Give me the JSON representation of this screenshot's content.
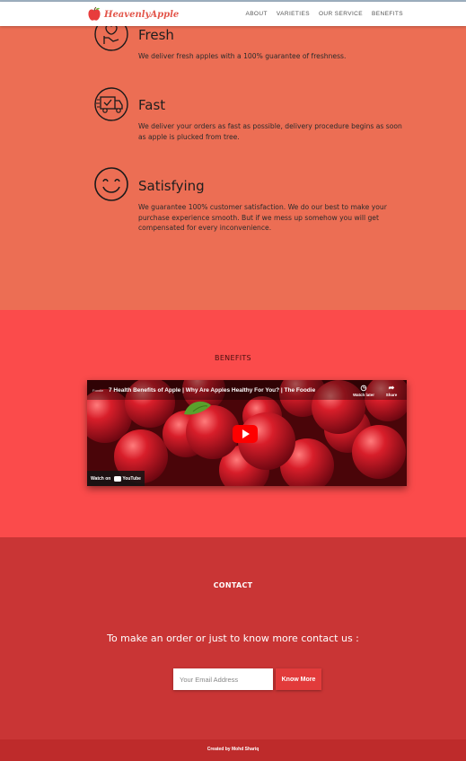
{
  "brand": {
    "name": "HeavenlyApple",
    "icon": "apple-icon"
  },
  "nav": {
    "items": [
      "About",
      "Varieties",
      "Our Service",
      "Benefits"
    ]
  },
  "features": [
    {
      "icon": "apple-hand-icon",
      "title": "Fresh",
      "text": "We deliver fresh apples with a 100% guarantee of freshness."
    },
    {
      "icon": "delivery-truck-icon",
      "title": "Fast",
      "text": "We deliver your orders as fast as possible, delivery procedure begins as soon as apple is plucked from tree."
    },
    {
      "icon": "smiley-icon",
      "title": "Satisfying",
      "text": "We guarantee 100% customer satisfaction. We do our best to make your purchase experience smooth. But if we mess up somehow you will get compensated for every inconvenience."
    }
  ],
  "benefits": {
    "heading": "BENEFITS",
    "video": {
      "channel": "Foodie",
      "title": "7 Health Benefits of Apple | Why Are Apples Healthy For You? | The Foodie",
      "watch_later": "Watch later",
      "share": "Share",
      "watch_on": "Watch on",
      "youtube": "YouTube"
    }
  },
  "contact": {
    "heading": "CONTACT",
    "tagline": "To make an order or just to know more contact us :",
    "email_placeholder": "Your Email Address",
    "button": "Know More"
  },
  "footer": {
    "credit": "Created by Mohd Shariq"
  },
  "colors": {
    "features_bg": "#ec6e54",
    "benefits_bg": "#fb4b4b",
    "contact_bg": "#c93535",
    "footer_bg": "#be2b2b",
    "accent": "#e23b3b"
  }
}
